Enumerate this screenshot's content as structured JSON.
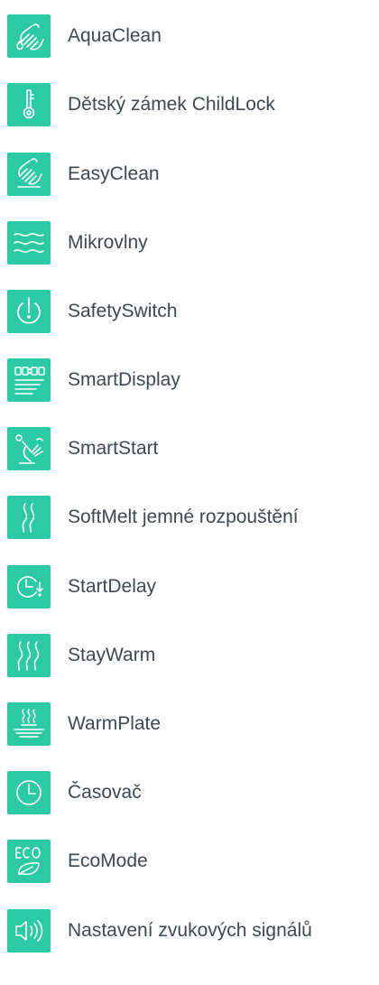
{
  "accent_color": "#2bcaa5",
  "text_color": "#3f4750",
  "features": [
    {
      "label": "AquaClean",
      "icon": "hand-wash-drop-icon"
    },
    {
      "label": "Dětský zámek ChildLock",
      "icon": "key-lock-icon"
    },
    {
      "label": "EasyClean",
      "icon": "hand-wipe-icon"
    },
    {
      "label": "Mikrovlny",
      "icon": "microwave-waves-icon"
    },
    {
      "label": "SafetySwitch",
      "icon": "power-icon"
    },
    {
      "label": "SmartDisplay",
      "icon": "digital-display-icon"
    },
    {
      "label": "SmartStart",
      "icon": "hand-start-icon"
    },
    {
      "label": "SoftMelt jemné rozpouštění",
      "icon": "soft-melt-waves-icon"
    },
    {
      "label": "StartDelay",
      "icon": "clock-delay-icon"
    },
    {
      "label": "StayWarm",
      "icon": "warm-waves-icon"
    },
    {
      "label": "WarmPlate",
      "icon": "warm-plate-icon"
    },
    {
      "label": "Časovač",
      "icon": "timer-clock-icon"
    },
    {
      "label": "EcoMode",
      "icon": "eco-leaf-icon"
    },
    {
      "label": "Nastavení zvukových signálů",
      "icon": "speaker-sound-icon"
    }
  ]
}
